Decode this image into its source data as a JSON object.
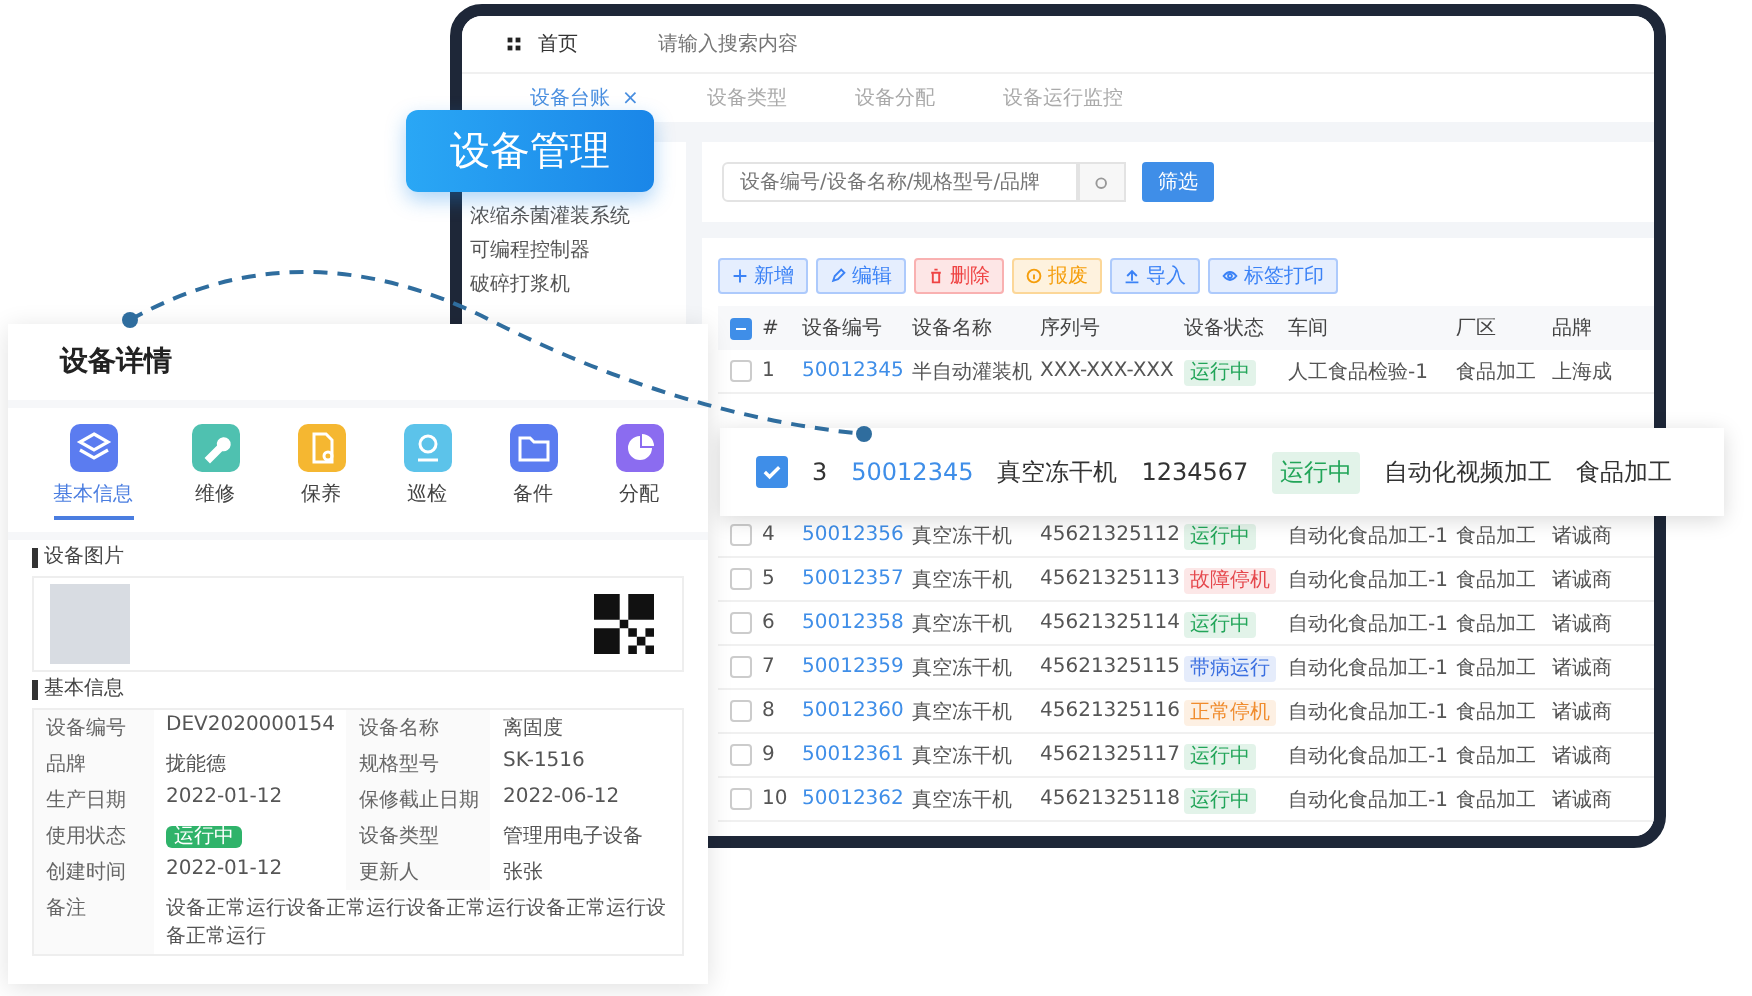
{
  "main_window": {
    "top_bar": {
      "home": "首页",
      "search_placeholder": "请输入搜索内容"
    },
    "tabs": [
      {
        "label": "设备台账",
        "selected": true,
        "close": "×"
      },
      {
        "label": "设备类型",
        "selected": false
      },
      {
        "label": "设备分配",
        "selected": false
      },
      {
        "label": "设备运行监控",
        "selected": false
      }
    ],
    "sidebar": {
      "items": [
        "浓缩杀菌灌装系统",
        "可编程控制器",
        "破碎打浆机"
      ]
    },
    "filter": {
      "placeholder": "设备编号/设备名称/规格型号/品牌",
      "button": "筛选"
    },
    "toolbar": [
      {
        "label": "新增",
        "color": "#3b82f6"
      },
      {
        "label": "编辑",
        "color": "#3b82f6"
      },
      {
        "label": "删除",
        "color": "#ef4444"
      },
      {
        "label": "报废",
        "color": "#f59e0b"
      },
      {
        "label": "导入",
        "color": "#3b82f6"
      },
      {
        "label": "标签打印",
        "color": "#3b82f6"
      }
    ],
    "table": {
      "select_all_indeterminate": true,
      "columns": [
        "#",
        "设备编号",
        "设备名称",
        "序列号",
        "设备状态",
        "车间",
        "厂区",
        "品牌"
      ],
      "rows": [
        {
          "checked": false,
          "cells": [
            "1",
            "50012345",
            "半自动灌装机",
            "XXX-XXX-XXX",
            {
              "label": "运行中",
              "color": "#22a559"
            },
            "人工食品检验-1",
            "食品加工",
            "上海成"
          ]
        },
        {
          "checked": false,
          "cells": [
            "4",
            "50012356",
            "真空冻干机",
            "45621325112",
            {
              "label": "运行中",
              "color": "#22a559"
            },
            "自动化食品加工-1",
            "食品加工",
            "诸诚商"
          ]
        },
        {
          "checked": false,
          "cells": [
            "5",
            "50012357",
            "真空冻干机",
            "45621325113",
            {
              "label": "故障停机",
              "color": "#e5484d"
            },
            "自动化食品加工-1",
            "食品加工",
            "诸诚商"
          ]
        },
        {
          "checked": false,
          "cells": [
            "6",
            "50012358",
            "真空冻干机",
            "45621325114",
            {
              "label": "运行中",
              "color": "#22a559"
            },
            "自动化食品加工-1",
            "食品加工",
            "诸诚商"
          ]
        },
        {
          "checked": false,
          "cells": [
            "7",
            "50012359",
            "真空冻干机",
            "45621325115",
            {
              "label": "带病运行",
              "color": "#3b6fe0"
            },
            "自动化食品加工-1",
            "食品加工",
            "诸诚商"
          ]
        },
        {
          "checked": false,
          "cells": [
            "8",
            "50012360",
            "真空冻干机",
            "45621325116",
            {
              "label": "正常停机",
              "color": "#f08c2e"
            },
            "自动化食品加工-1",
            "食品加工",
            "诸诚商"
          ]
        },
        {
          "checked": false,
          "cells": [
            "9",
            "50012361",
            "真空冻干机",
            "45621325117",
            {
              "label": "运行中",
              "color": "#22a559"
            },
            "自动化食品加工-1",
            "食品加工",
            "诸诚商"
          ]
        },
        {
          "checked": false,
          "cells": [
            "10",
            "50012362",
            "真空冻干机",
            "45621325118",
            {
              "label": "运行中",
              "color": "#22a559"
            },
            "自动化食品加工-1",
            "食品加工",
            "诸诚商"
          ]
        }
      ]
    }
  },
  "badge": "设备管理",
  "highlighted_row": {
    "checked": true,
    "cells": [
      "3",
      "50012345",
      "真空冻干机",
      "1234567",
      "自动化视频加工",
      "食品加工"
    ],
    "status": {
      "label": "运行中",
      "color": "#22a559"
    }
  },
  "detail_card": {
    "title": "设备详情",
    "tabs": [
      {
        "label": "基本信息",
        "color": "#5b7cf0",
        "selected": true
      },
      {
        "label": "维修",
        "color": "#4fc1b0",
        "selected": false
      },
      {
        "label": "保养",
        "color": "#f5b731",
        "selected": false
      },
      {
        "label": "巡检",
        "color": "#5cc3ea",
        "selected": false
      },
      {
        "label": "备件",
        "color": "#5b7cf0",
        "selected": false
      },
      {
        "label": "分配",
        "color": "#8b6cf0",
        "selected": false
      }
    ],
    "image_section": "设备图片",
    "info_section": "基本信息",
    "info": [
      {
        "label": "设备编号",
        "value": "DEV2020000154",
        "kind": "text"
      },
      {
        "label": "设备名称",
        "value": "离固度",
        "kind": "text"
      },
      {
        "label": "品牌",
        "value": "拢能德",
        "kind": "text"
      },
      {
        "label": "规格型号",
        "value": "SK-1516",
        "kind": "text"
      },
      {
        "label": "生产日期",
        "value": "2022-01-12",
        "kind": "text"
      },
      {
        "label": "保修截止日期",
        "value": "2022-06-12",
        "kind": "text"
      },
      {
        "label": "使用状态",
        "value": "运行中",
        "kind": "badge"
      },
      {
        "label": "设备类型",
        "value": "管理用电子设备",
        "kind": "text"
      },
      {
        "label": "创建时间",
        "value": "2022-01-12",
        "kind": "text"
      },
      {
        "label": "更新人",
        "value": "张张",
        "kind": "text"
      },
      {
        "label": "备注",
        "value": "设备正常运行设备正常运行设备正常运行设备正常运行设备正常运行",
        "kind": "wide"
      }
    ]
  }
}
